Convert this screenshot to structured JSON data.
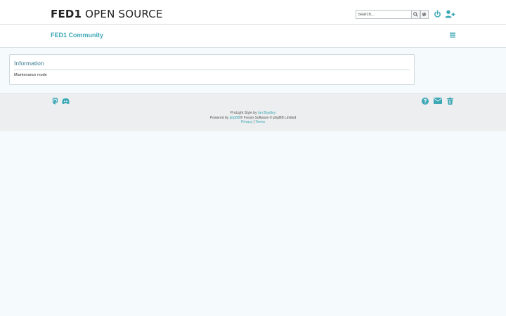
{
  "header": {
    "logo_bold": "FED1",
    "logo_rest": " OPEN SOURCE",
    "search": {
      "placeholder": "Search..."
    },
    "icons": [
      "search-icon",
      "gear-icon",
      "power-icon",
      "user-plus-icon"
    ]
  },
  "nav": {
    "community_link": "FED1 Community",
    "menu_icon": "hamburger-icon"
  },
  "panel": {
    "title": "Information",
    "message": "Maintenance mode"
  },
  "footer": {
    "left_icons": [
      "mastodon-icon",
      "discord-icon"
    ],
    "right_icons": [
      "question-circle-icon",
      "envelope-icon",
      "trash-icon"
    ],
    "style_prefix": "ProLight Style by ",
    "style_author": "Ian Bradley",
    "powered_prefix": "Powered by ",
    "powered_link": "phpBB",
    "powered_suffix": "® Forum Software © phpBB Limited",
    "privacy": "Privacy",
    "separator": " | ",
    "terms": "Terms"
  },
  "colors": {
    "accent": "#3ca7b5",
    "panel_title": "#3a7c92",
    "page_bg": "#f5fbfc",
    "footer_bg": "#eceeef"
  }
}
